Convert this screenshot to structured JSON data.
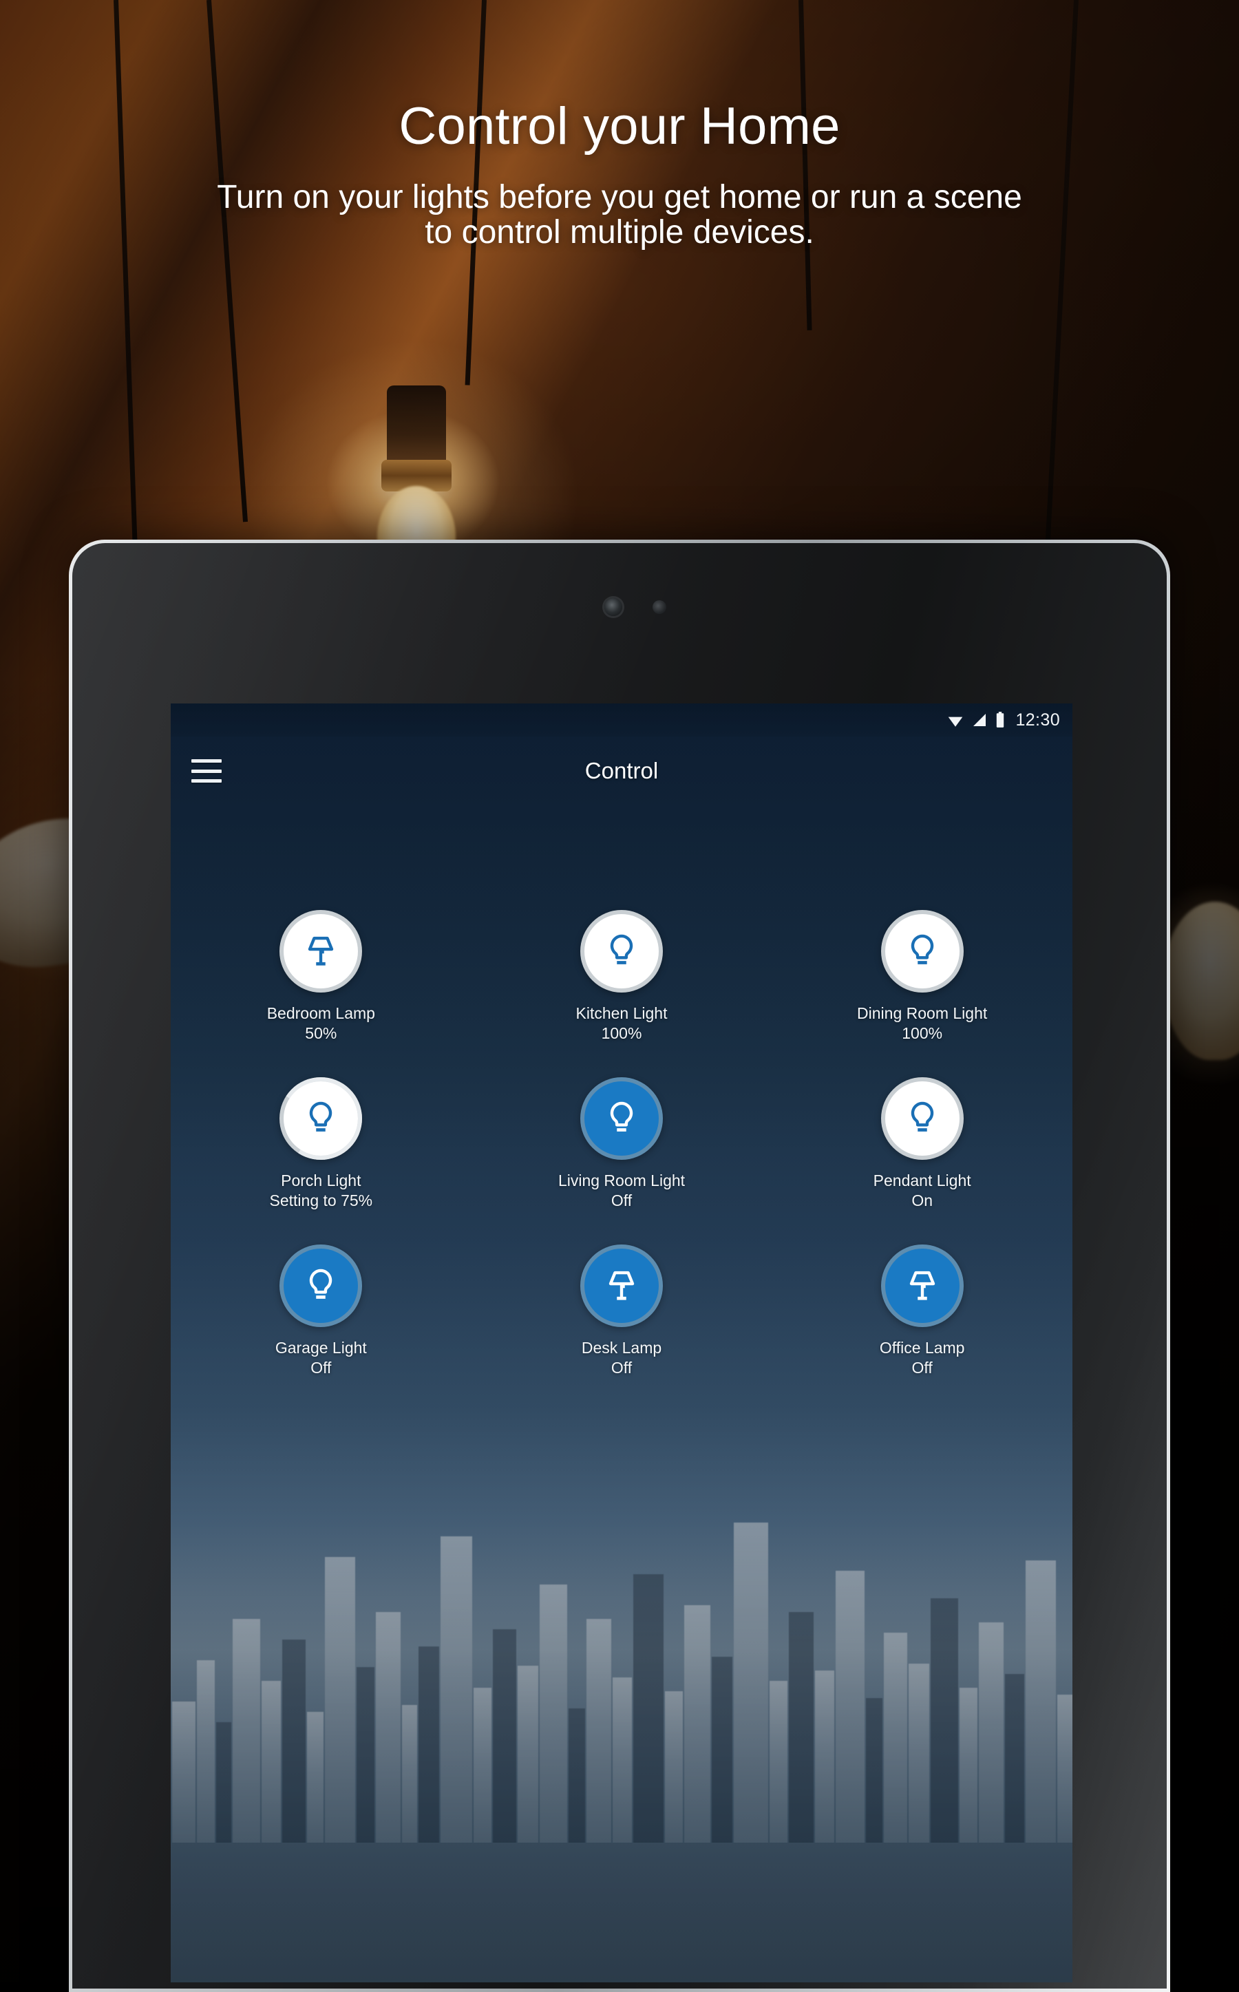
{
  "promo": {
    "title": "Control your Home",
    "subtitle": "Turn on your lights before you get home or run a scene to control multiple devices."
  },
  "colors": {
    "accent_blue": "#1a7ac4",
    "icon_blue": "#1a6fb5",
    "circle_white": "#ffffff",
    "circle_ring": "#c6ccd1",
    "text_white": "#f4f7f9"
  },
  "statusbar": {
    "wifi_icon": "wifi-icon",
    "signal_icon": "cell-signal-icon",
    "battery_icon": "battery-full-icon",
    "time": "12:30"
  },
  "appbar": {
    "menu_icon": "hamburger-menu-icon",
    "title": "Control"
  },
  "devices": [
    {
      "name": "Bedroom Lamp",
      "state": "50%",
      "icon": "table-lamp-icon",
      "mode": "off"
    },
    {
      "name": "Kitchen Light",
      "state": "100%",
      "icon": "light-bulb-icon",
      "mode": "off"
    },
    {
      "name": "Dining Room Light",
      "state": "100%",
      "icon": "light-bulb-icon",
      "mode": "off"
    },
    {
      "name": "Porch Light",
      "state": "Setting to 75%",
      "icon": "light-bulb-icon",
      "mode": "progress"
    },
    {
      "name": "Living Room Light",
      "state": "Off",
      "icon": "light-bulb-icon",
      "mode": "on"
    },
    {
      "name": "Pendant Light",
      "state": "On",
      "icon": "light-bulb-icon",
      "mode": "off"
    },
    {
      "name": "Garage Light",
      "state": "Off",
      "icon": "light-bulb-icon",
      "mode": "on"
    },
    {
      "name": "Desk Lamp",
      "state": "Off",
      "icon": "table-lamp-icon",
      "mode": "on"
    },
    {
      "name": "Office Lamp",
      "state": "Off",
      "icon": "table-lamp-icon",
      "mode": "on"
    }
  ]
}
